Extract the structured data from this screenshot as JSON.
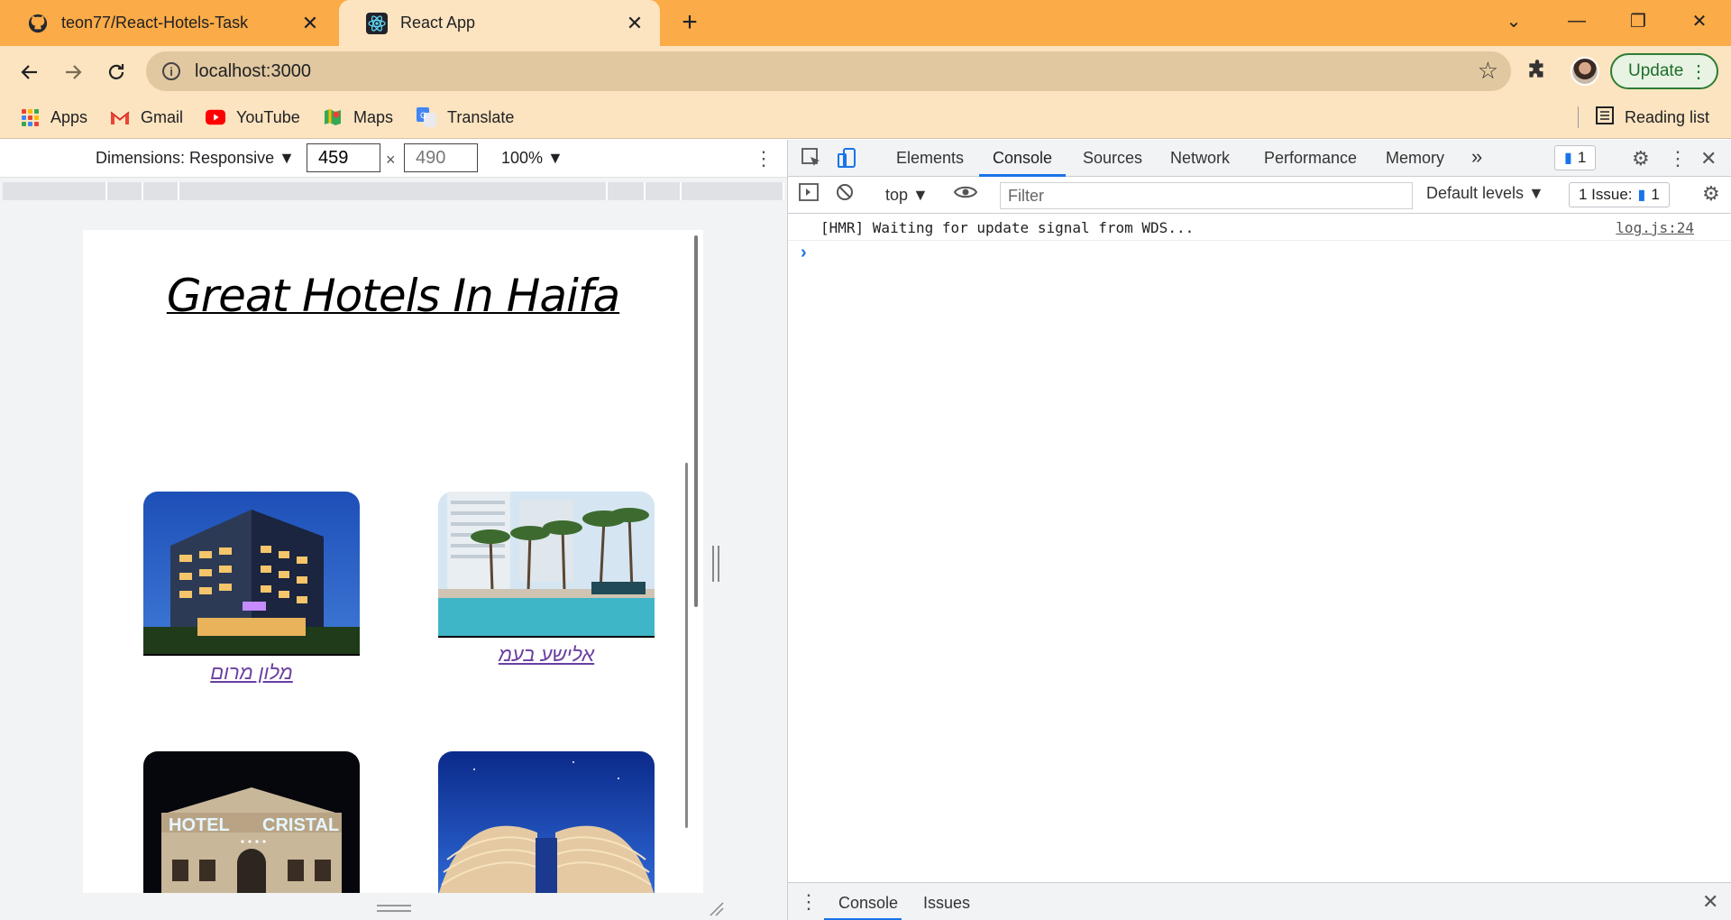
{
  "browser": {
    "tabs": [
      {
        "title": "teon77/React-Hotels-Task",
        "icon": "github-icon"
      },
      {
        "title": "React App",
        "icon": "react-icon"
      }
    ],
    "close_glyph": "✕",
    "new_tab_glyph": "+",
    "window_controls": {
      "dropdown": "⌄",
      "minimize": "—",
      "restore": "❐",
      "close": "✕"
    },
    "url": "localhost:3000",
    "update_label": "Update",
    "bookmarks": [
      {
        "label": "Apps"
      },
      {
        "label": "Gmail"
      },
      {
        "label": "YouTube"
      },
      {
        "label": "Maps"
      },
      {
        "label": "Translate"
      }
    ],
    "reading_list": "Reading list",
    "accent_color": "#fbab47"
  },
  "device_toolbar": {
    "dimensions_label": "Dimensions: Responsive ▼",
    "width": "459",
    "height": "490",
    "times": "×",
    "zoom": "100% ▼"
  },
  "page": {
    "title": "Great Hotels In Haifa",
    "hotels": [
      {
        "name": "מלון מרום"
      },
      {
        "name": "אלישע בעמ"
      },
      {
        "name": ""
      },
      {
        "name": ""
      }
    ],
    "sign_text": {
      "left": "HOTEL",
      "right": "CRISTAL"
    }
  },
  "devtools": {
    "tabs": [
      "Elements",
      "Console",
      "Sources",
      "Network",
      "Performance",
      "Memory"
    ],
    "active_tab": "Console",
    "overflow": "»",
    "message_count": "1",
    "context": "top ▼",
    "filter_placeholder": "Filter",
    "levels": "Default levels ▼",
    "issues_label": "1 Issue:",
    "issues_count": "1",
    "log_message": "[HMR] Waiting for update signal from WDS...",
    "log_source": "log.js:24",
    "prompt": "›",
    "drawer_tabs": [
      "Console",
      "Issues"
    ]
  }
}
